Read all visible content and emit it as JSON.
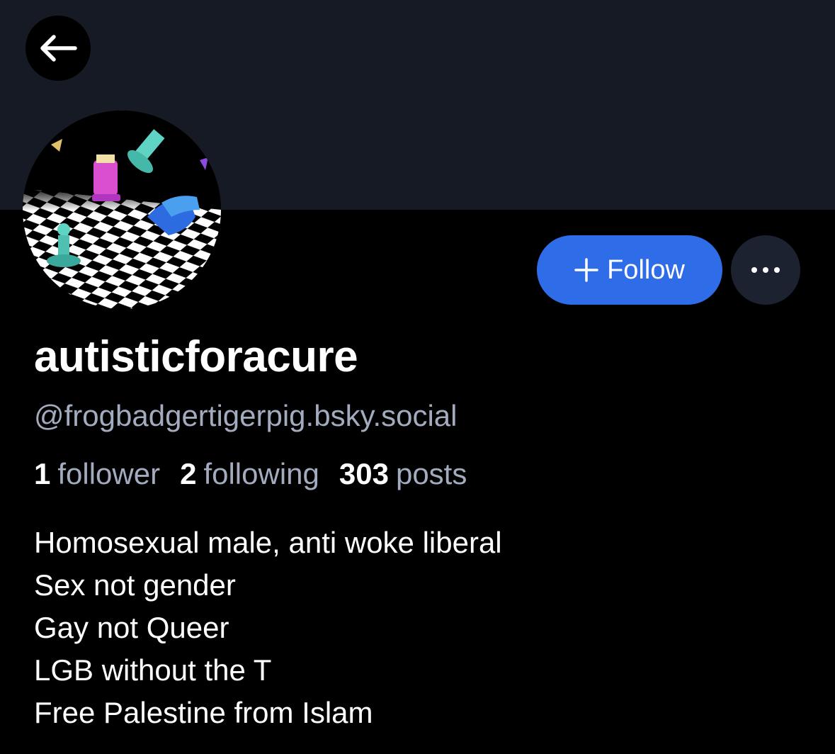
{
  "colors": {
    "banner": "#151a24",
    "background": "#000000",
    "accent": "#2f6de8",
    "muted_text": "#a3abbf",
    "more_button_bg": "#1c2230"
  },
  "icons": {
    "back": "arrow-left-icon",
    "follow": "plus-icon",
    "more": "ellipsis-icon"
  },
  "profile": {
    "display_name": "autisticforacure",
    "handle": "@frogbadgertigerpig.bsky.social",
    "stats": {
      "followers_count": "1",
      "followers_label": "follower",
      "following_count": "2",
      "following_label": "following",
      "posts_count": "303",
      "posts_label": "posts"
    },
    "bio": [
      "Homosexual male, anti woke liberal",
      "Sex not gender",
      "Gay not Queer",
      "LGB without the T",
      "Free Palestine from Islam"
    ]
  },
  "actions": {
    "follow_label": "Follow"
  }
}
